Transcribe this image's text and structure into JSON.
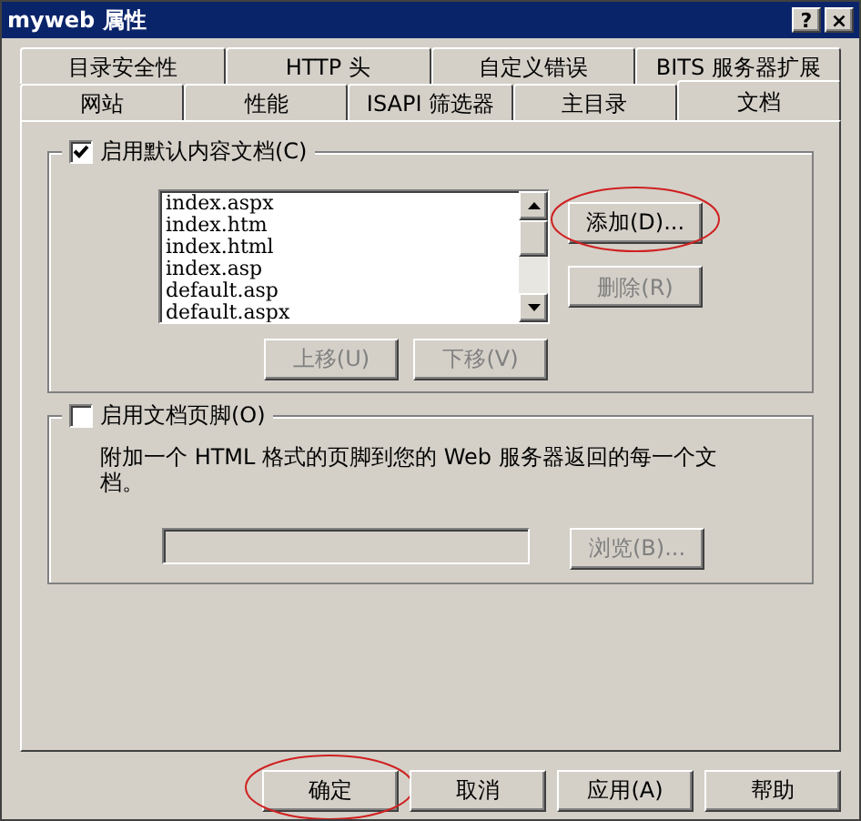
{
  "window": {
    "title": "myweb 属性",
    "title_buttons": [
      "?",
      "×"
    ]
  },
  "tab_rows": [
    [
      {
        "label": "目录安全性",
        "selected": false
      },
      {
        "label": "HTTP 头",
        "selected": false
      },
      {
        "label": "自定义错误",
        "selected": false
      },
      {
        "label": "BITS 服务器扩展",
        "selected": false
      }
    ],
    [
      {
        "label": "网站",
        "selected": false
      },
      {
        "label": "性能",
        "selected": false
      },
      {
        "label": "ISAPI 筛选器",
        "selected": false
      },
      {
        "label": "主目录",
        "selected": false
      },
      {
        "label": "文档",
        "selected": true
      }
    ]
  ],
  "default_docs": {
    "label": "启用默认内容文档(C)",
    "checked": true,
    "documents": [
      "index.aspx",
      "index.htm",
      "index.html",
      "index.asp",
      "default.asp",
      "default.aspx"
    ],
    "side_buttons": [
      {
        "label": "添加(D)...",
        "disabled": false,
        "highlighted": true
      },
      {
        "label": "删除(R)",
        "disabled": true,
        "highlighted": false
      }
    ],
    "move_buttons": [
      {
        "label": "上移(U)",
        "disabled": true
      },
      {
        "label": "下移(V)",
        "disabled": true
      }
    ]
  },
  "footer": {
    "label": "启用文档页脚(O)",
    "checked": false,
    "description": "附加一个 HTML 格式的页脚到您的 Web 服务器返回的每一个文档。",
    "browse": {
      "label": "浏览(B)...",
      "disabled": true
    }
  },
  "buttons": [
    {
      "label": "确定",
      "highlighted": true
    },
    {
      "label": "取消",
      "highlighted": false
    },
    {
      "label": "应用(A)",
      "highlighted": false
    },
    {
      "label": "帮助",
      "highlighted": false
    }
  ]
}
